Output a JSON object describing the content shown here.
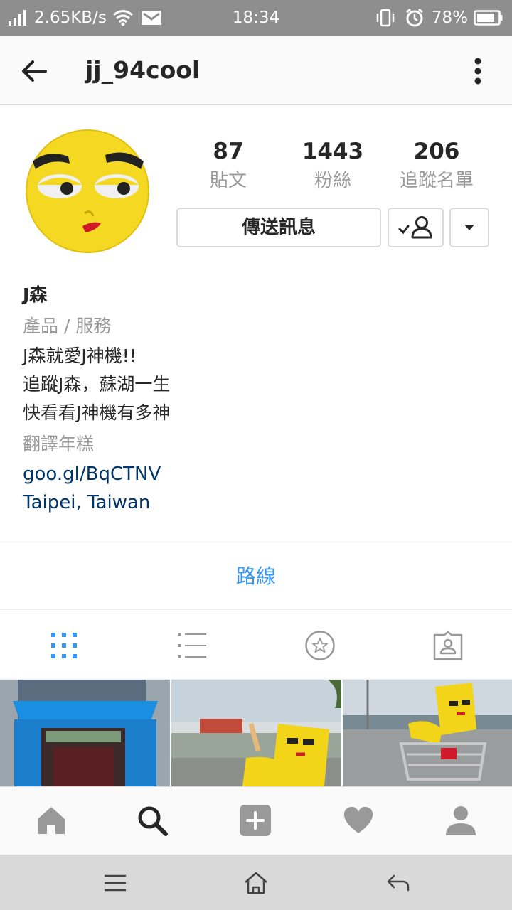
{
  "status_bar": {
    "net_speed": "2.65KB/s",
    "time": "18:34",
    "battery": "78%"
  },
  "header": {
    "username": "jj_94cool"
  },
  "stats": [
    {
      "value": "87",
      "label": "貼文"
    },
    {
      "value": "1443",
      "label": "粉絲"
    },
    {
      "value": "206",
      "label": "追蹤名單"
    }
  ],
  "actions": {
    "message_label": "傳送訊息"
  },
  "bio": {
    "name": "J森",
    "category": "產品 / 服務",
    "lines": [
      "J森就愛J神機!!",
      "追蹤J森，蘇湖一生",
      "快看看J神機有多神"
    ],
    "translate": "翻譯年糕",
    "link": "goo.gl/BqCTNV",
    "location": "Taipei, Taiwan"
  },
  "route_label": "路線",
  "colors": {
    "accent": "#3897f0",
    "link": "#003569",
    "status_bar": "#8e8e8e",
    "avatar_yellow": "#f5d821"
  }
}
